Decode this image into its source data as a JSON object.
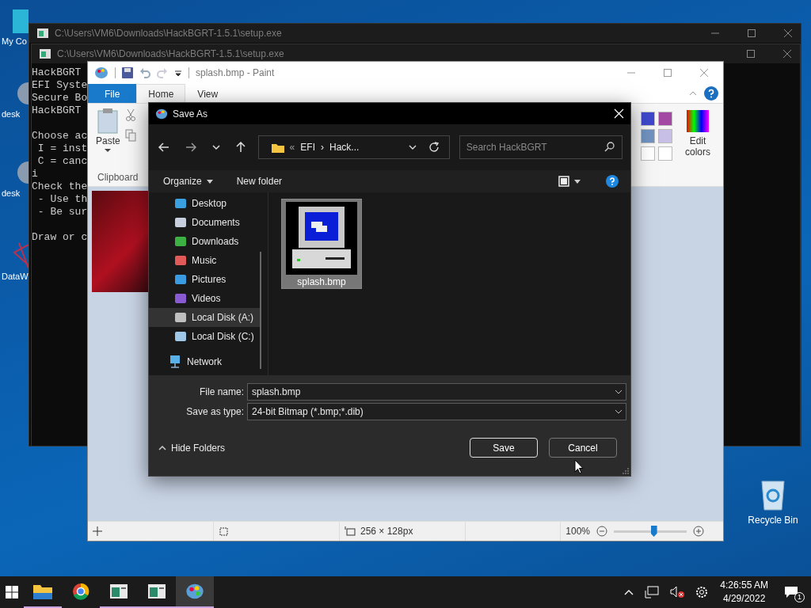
{
  "desktop": {
    "icons": [
      {
        "label": "My Co",
        "kind": "monitor"
      },
      {
        "label": "desk",
        "kind": "gear"
      },
      {
        "label": "desk",
        "kind": "gear"
      },
      {
        "label": "DataW",
        "kind": "shortcut"
      }
    ],
    "recycle_bin": {
      "label": "Recycle Bin"
    }
  },
  "consoles": [
    {
      "title": "C:\\Users\\VM6\\Downloads\\HackBGRT-1.5.1\\setup.exe"
    },
    {
      "title": "C:\\Users\\VM6\\Downloads\\HackBGRT-1.5.1\\setup.exe",
      "blocks": [
        [
          "HackBGRT",
          "EFI Syste",
          "Secure Bo",
          "HackBGRT"
        ],
        [
          "Choose ac",
          " I = inst",
          " C = canc",
          "i",
          "Check the",
          " - Use th",
          " - Be sur"
        ],
        [
          "Draw or c"
        ]
      ]
    }
  ],
  "paint": {
    "title": "splash.bmp - Paint",
    "tabs": [
      {
        "label": "File",
        "kind": "file",
        "selected": false
      },
      {
        "label": "Home",
        "kind": "tab",
        "selected": true
      },
      {
        "label": "View",
        "kind": "tab",
        "selected": false
      }
    ],
    "ribbon": {
      "paste": "Paste",
      "group": "Clipboard",
      "edit_colors": "Edit colors",
      "palette": [
        {
          "color": "#3f48cc"
        },
        {
          "color": "#a349a4"
        },
        {
          "color": "#7092be"
        },
        {
          "color": "#c8bfe7"
        },
        {
          "color": "#ffffff"
        },
        {
          "color": "#ffffff"
        }
      ]
    },
    "status": {
      "size": "256 × 128px",
      "zoom": "100%",
      "zoom_slider": {
        "level": 0.55
      }
    }
  },
  "dialog": {
    "title": "Save As",
    "breadcrumb": {
      "overflow": "«",
      "parts": [
        "EFI",
        "Hack..."
      ],
      "separator": "›"
    },
    "search": {
      "placeholder": "Search HackBGRT"
    },
    "toolbar": {
      "organize": "Organize",
      "new_folder": "New folder"
    },
    "sidebar": {
      "items": [
        {
          "label": "Desktop",
          "kind": "desktop",
          "selected": false
        },
        {
          "label": "Documents",
          "kind": "documents",
          "selected": false
        },
        {
          "label": "Downloads",
          "kind": "downloads",
          "selected": false
        },
        {
          "label": "Music",
          "kind": "music",
          "selected": false
        },
        {
          "label": "Pictures",
          "kind": "pictures",
          "selected": false
        },
        {
          "label": "Videos",
          "kind": "videos",
          "selected": false
        },
        {
          "label": "Local Disk (A:)",
          "kind": "disk",
          "selected": true
        },
        {
          "label": "Local Disk (C:)",
          "kind": "system_disk",
          "selected": false
        }
      ],
      "network": {
        "label": "Network",
        "selected": false
      }
    },
    "files": [
      {
        "name": "splash.bmp",
        "selected": true
      }
    ],
    "file_name": {
      "label": "File name:",
      "value": "splash.bmp"
    },
    "save_as_type": {
      "label": "Save as type:",
      "value": "24-bit Bitmap (*.bmp;*.dib)"
    },
    "hide_folders": "Hide Folders",
    "buttons": [
      {
        "label": "Save",
        "kind": "default"
      },
      {
        "label": "Cancel",
        "kind": "normal"
      }
    ]
  },
  "taskbar": {
    "apps": [
      {
        "kind": "explorer",
        "running": true,
        "active": false
      },
      {
        "kind": "chrome",
        "running": false,
        "active": false
      },
      {
        "kind": "console",
        "running": true,
        "active": false
      },
      {
        "kind": "console",
        "running": true,
        "active": false
      },
      {
        "kind": "paint",
        "running": true,
        "active": true
      }
    ],
    "clock": {
      "time": "4:26:55 AM",
      "date": "4/29/2022"
    },
    "notifications": "1"
  }
}
